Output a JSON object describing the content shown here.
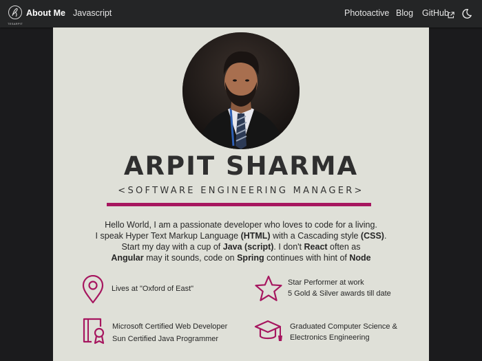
{
  "nav": {
    "logo_text": "TESARPIT",
    "about": "About Me",
    "javascript": "Javascript",
    "photoactive": "Photoactive",
    "blog": "Blog",
    "github": "GitHub"
  },
  "profile": {
    "name": "ARPIT SHARMA",
    "role": "<SOFTWARE ENGINEERING MANAGER>",
    "bio": {
      "l1": "Hello World, I am a passionate developer who loves to code for a living.",
      "l2_a": "I speak Hyper Text Markup Language ",
      "l2_b": "(HTML)",
      "l2_c": " with a Cascading style ",
      "l2_d": "(CSS)",
      "l2_e": ".",
      "l3_a": "Start my day with a cup of ",
      "l3_b": "Java (script)",
      "l3_c": ".  I don't ",
      "l3_d": "React",
      "l3_e": " often as",
      "l4_a": "Angular",
      "l4_b": " may it sounds, code on ",
      "l4_c": "Spring",
      "l4_d": " continues with hint of ",
      "l4_e": "Node"
    }
  },
  "features": {
    "location": "Lives at  \"Oxford of East\"",
    "star_1": "Star Performer at work",
    "star_2": "5 Gold & Silver awards till date",
    "cert_1": "Microsoft Certified Web Developer",
    "cert_2": "Sun Certified Java Programmer",
    "edu_1": "Graduated Computer Science &",
    "edu_2": "Electronics Engineering"
  },
  "colors": {
    "accent": "#a6165f",
    "card_bg": "#dfe0d8",
    "navbar_bg": "#242526",
    "page_bg": "#1b1b1d"
  },
  "icons": {
    "logo": "signature-logo-icon",
    "external": "external-link-icon",
    "theme": "moon-icon",
    "location": "map-pin-icon",
    "star": "star-icon",
    "certificate": "certificate-icon",
    "education": "graduation-cap-icon"
  }
}
